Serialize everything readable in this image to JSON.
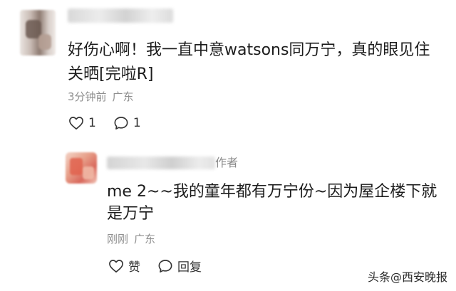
{
  "comment": {
    "text": "好伤心啊！我一直中意watsons同万宁，真的眼见住关晒[完啦R]",
    "time": "3分钟前",
    "location": "广东",
    "like_count": "1",
    "reply_count": "1"
  },
  "reply": {
    "author_tag": "作者",
    "text": "me 2~~我的童年都有万宁份~因为屋企楼下就是万宁",
    "time": "刚刚",
    "location": "广东",
    "like_label": "赞",
    "reply_label": "回复"
  },
  "watermark": "头条@西安晚报",
  "icons": [
    "heart-outline-icon",
    "comment-bubble-icon"
  ],
  "colors": {
    "text": "#1c1c1c",
    "meta": "#8f8f8f",
    "background": "#ffffff"
  }
}
